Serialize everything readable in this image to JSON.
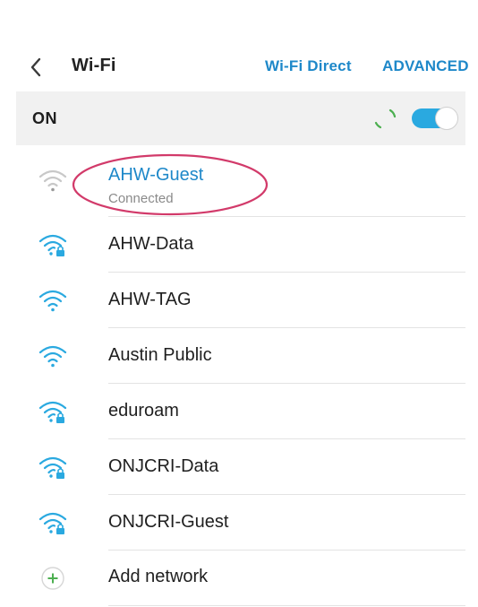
{
  "header": {
    "title": "Wi-Fi",
    "wifi_direct_label": "Wi-Fi Direct",
    "advanced_label": "ADVANCED"
  },
  "status": {
    "on_label": "ON"
  },
  "colors": {
    "accent": "#1e88c9",
    "toggle": "#2aa9e0",
    "spinner": "#4caf50",
    "highlight": "#d23a6a",
    "add_icon": "#4caf50"
  },
  "networks": [
    {
      "name": "AHW-Guest",
      "status": "Connected",
      "icon": "wifi-weak-icon",
      "connected": true
    },
    {
      "name": "AHW-Data",
      "icon": "wifi-locked-icon"
    },
    {
      "name": "AHW-TAG",
      "icon": "wifi-icon"
    },
    {
      "name": "Austin Public",
      "icon": "wifi-icon"
    },
    {
      "name": "eduroam",
      "icon": "wifi-locked-icon"
    },
    {
      "name": "ONJCRI-Data",
      "icon": "wifi-locked-icon"
    },
    {
      "name": "ONJCRI-Guest",
      "icon": "wifi-locked-icon"
    }
  ],
  "add_network": {
    "label": "Add network",
    "icon": "plus-icon"
  }
}
